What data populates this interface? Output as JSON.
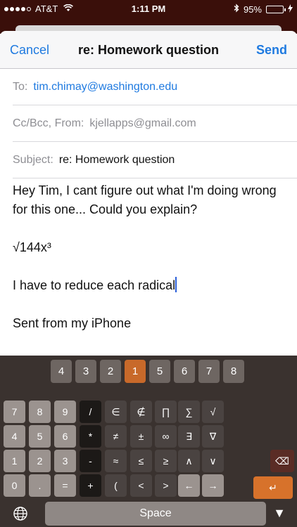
{
  "status": {
    "carrier": "AT&T",
    "time": "1:11 PM",
    "battery": "95%",
    "battery_level": 0.95
  },
  "nav": {
    "cancel": "Cancel",
    "title": "re: Homework question",
    "send": "Send"
  },
  "fields": {
    "to_label": "To:",
    "to_value": "tim.chimay@washington.edu",
    "cc_label": "Cc/Bcc, From:",
    "cc_value": "kjellapps@gmail.com",
    "subject_label": "Subject:",
    "subject_value": "re: Homework question"
  },
  "body": {
    "line1": "Hey Tim, I cant figure out what I'm doing wrong for this one... Could you explain?",
    "line2": "√144x³",
    "line3": "I have to reduce each radical",
    "line4": "Sent from my iPhone"
  },
  "keyboard": {
    "root_selector": [
      "4",
      "3",
      "2",
      "1",
      "5",
      "6",
      "7",
      "8"
    ],
    "root_active": "1",
    "row1": [
      "7",
      "8",
      "9",
      "/",
      "∈",
      "∉",
      "∏",
      "∑",
      "√"
    ],
    "row2": [
      "4",
      "5",
      "6",
      "*",
      "≠",
      "±",
      "∞",
      "∃",
      "∇"
    ],
    "row3": [
      "1",
      "2",
      "3",
      "-",
      "≈",
      "≤",
      "≥",
      "∧",
      "∨"
    ],
    "row4": [
      "0",
      ".",
      "=",
      "+",
      "(",
      "<",
      ">",
      "←",
      "→"
    ],
    "backspace": "⌫",
    "enter": "↵",
    "space": "Space",
    "hide": "▼"
  }
}
